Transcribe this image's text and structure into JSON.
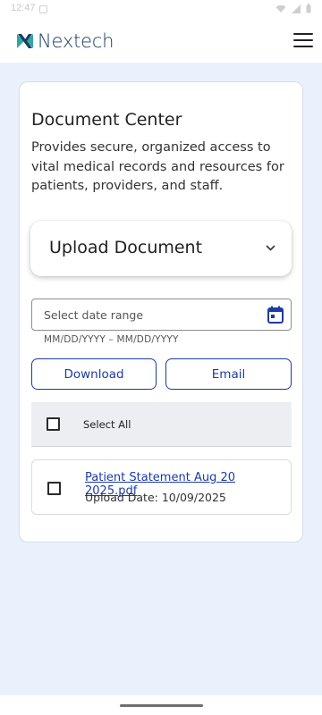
{
  "status_bar": {
    "time": "12:47"
  },
  "header": {
    "logo_text": "Nextech",
    "logo_colors": {
      "teal": "#2ea8a0",
      "navy": "#1d3a63"
    }
  },
  "card": {
    "title": "Document Center",
    "description": "Provides secure, organized access to vital medical records and resources for patients, providers, and staff.",
    "upload": {
      "label": "Upload Document"
    },
    "date_range": {
      "placeholder": "Select date range",
      "helper": "MM/DD/YYYY – MM/DD/YYYY"
    },
    "actions": {
      "download_label": "Download",
      "email_label": "Email"
    },
    "select_all_label": "Select All",
    "documents": [
      {
        "name": "Patient Statement Aug 20 2025.pdf",
        "upload_date": "Upload Date: 10/09/2025",
        "checked": false
      }
    ]
  },
  "colors": {
    "accent": "#1c3ba6",
    "page_background": "#e9f2fc"
  }
}
